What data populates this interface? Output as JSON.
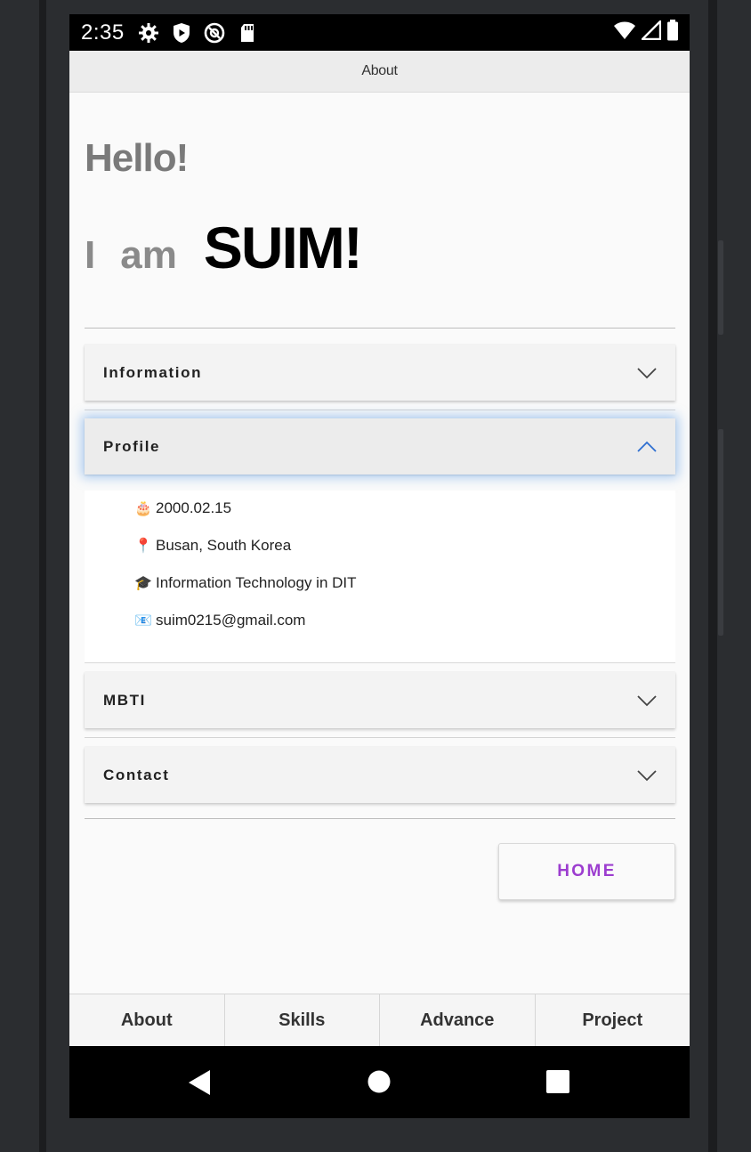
{
  "status_bar": {
    "time": "2:35",
    "icons": [
      "settings-icon",
      "shield-play-icon",
      "at-sign-icon",
      "sd-card-icon"
    ],
    "right_icons": [
      "wifi-icon",
      "signal-icon",
      "battery-icon"
    ]
  },
  "app_bar": {
    "title": "About"
  },
  "hero": {
    "greeting": "Hello!",
    "i": "I",
    "am": "am",
    "name": "SUIM!"
  },
  "accordion": {
    "information": {
      "label": "Information",
      "expanded": false
    },
    "profile": {
      "label": "Profile",
      "expanded": true,
      "items": [
        {
          "emoji": "🎂",
          "text": "2000.02.15"
        },
        {
          "emoji": "📍",
          "text": "Busan, South Korea"
        },
        {
          "emoji": "🎓",
          "text": "Information Technology in DIT"
        },
        {
          "emoji": "📧",
          "text": "suim0215@gmail.com"
        }
      ]
    },
    "mbti": {
      "label": "MBTI",
      "expanded": false
    },
    "contact": {
      "label": "Contact",
      "expanded": false
    }
  },
  "home_button": {
    "label": "HOME"
  },
  "bottom_nav": {
    "about": "About",
    "skills": "Skills",
    "advance": "Advance",
    "project": "Project"
  },
  "colors": {
    "accent": "#9c3dcf",
    "chevron_expanded": "#2f6fd1",
    "panel_glow": "#64a0e6",
    "status_bar": "#000000"
  },
  "system_nav": {
    "icons": [
      "back-icon",
      "home-circle-icon",
      "recents-icon"
    ]
  }
}
